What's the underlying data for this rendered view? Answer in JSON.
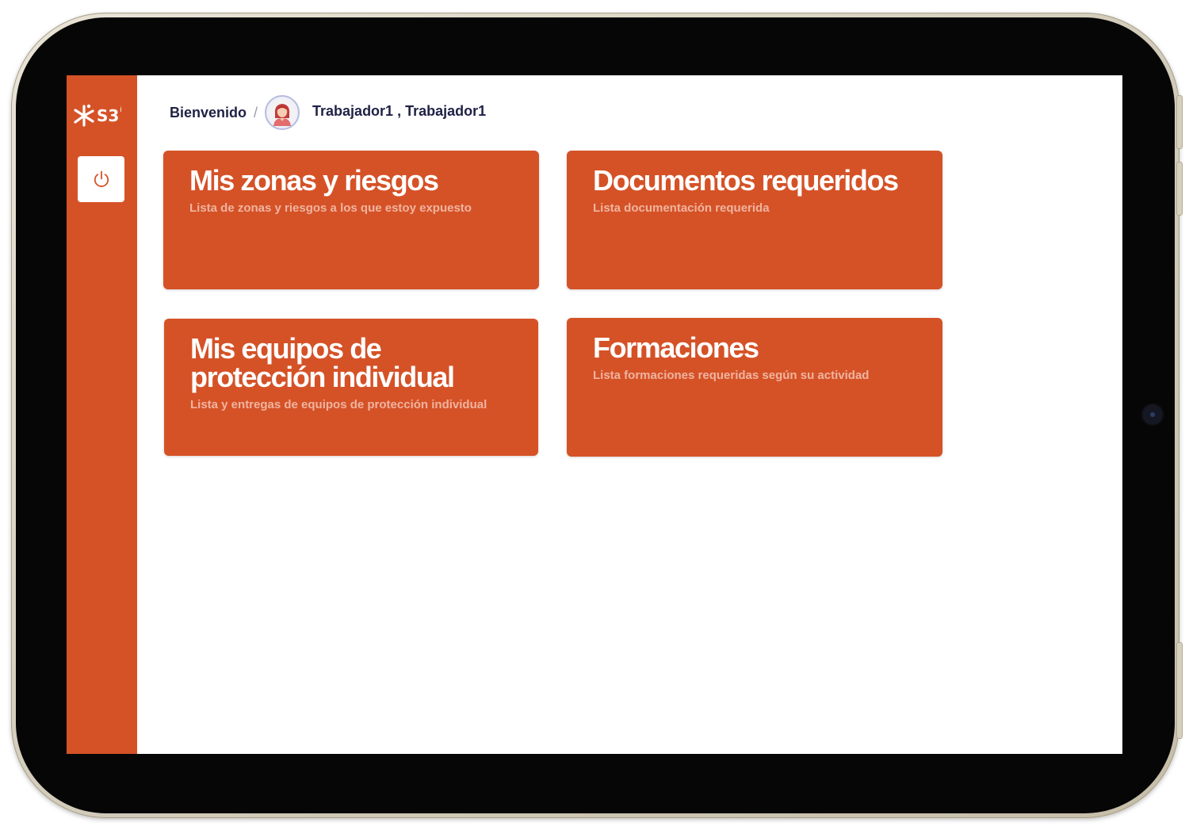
{
  "sidebar": {
    "logo_text": "S3",
    "logo_superscript": "i",
    "power_icon": "power-icon"
  },
  "header": {
    "welcome": "Bienvenido",
    "separator": "/",
    "avatar_icon": "user-avatar",
    "user_name": "Trabajador1 , Trabajador1"
  },
  "cards": [
    {
      "title": "Mis zonas y riesgos",
      "subtitle": "Lista de zonas y riesgos a los que estoy expuesto"
    },
    {
      "title": "Documentos requeridos",
      "subtitle": "Lista documentación requerida"
    },
    {
      "title": "Mis equipos de protección individual",
      "subtitle": "Lista y entregas de equipos de protección individual"
    },
    {
      "title": "Formaciones",
      "subtitle": "Lista formaciones requeridas según su actividad"
    }
  ],
  "colors": {
    "brand": "#d55227",
    "card_subtitle": "#f0b49f",
    "header_text": "#1f2145",
    "power_icon": "#d55227"
  }
}
